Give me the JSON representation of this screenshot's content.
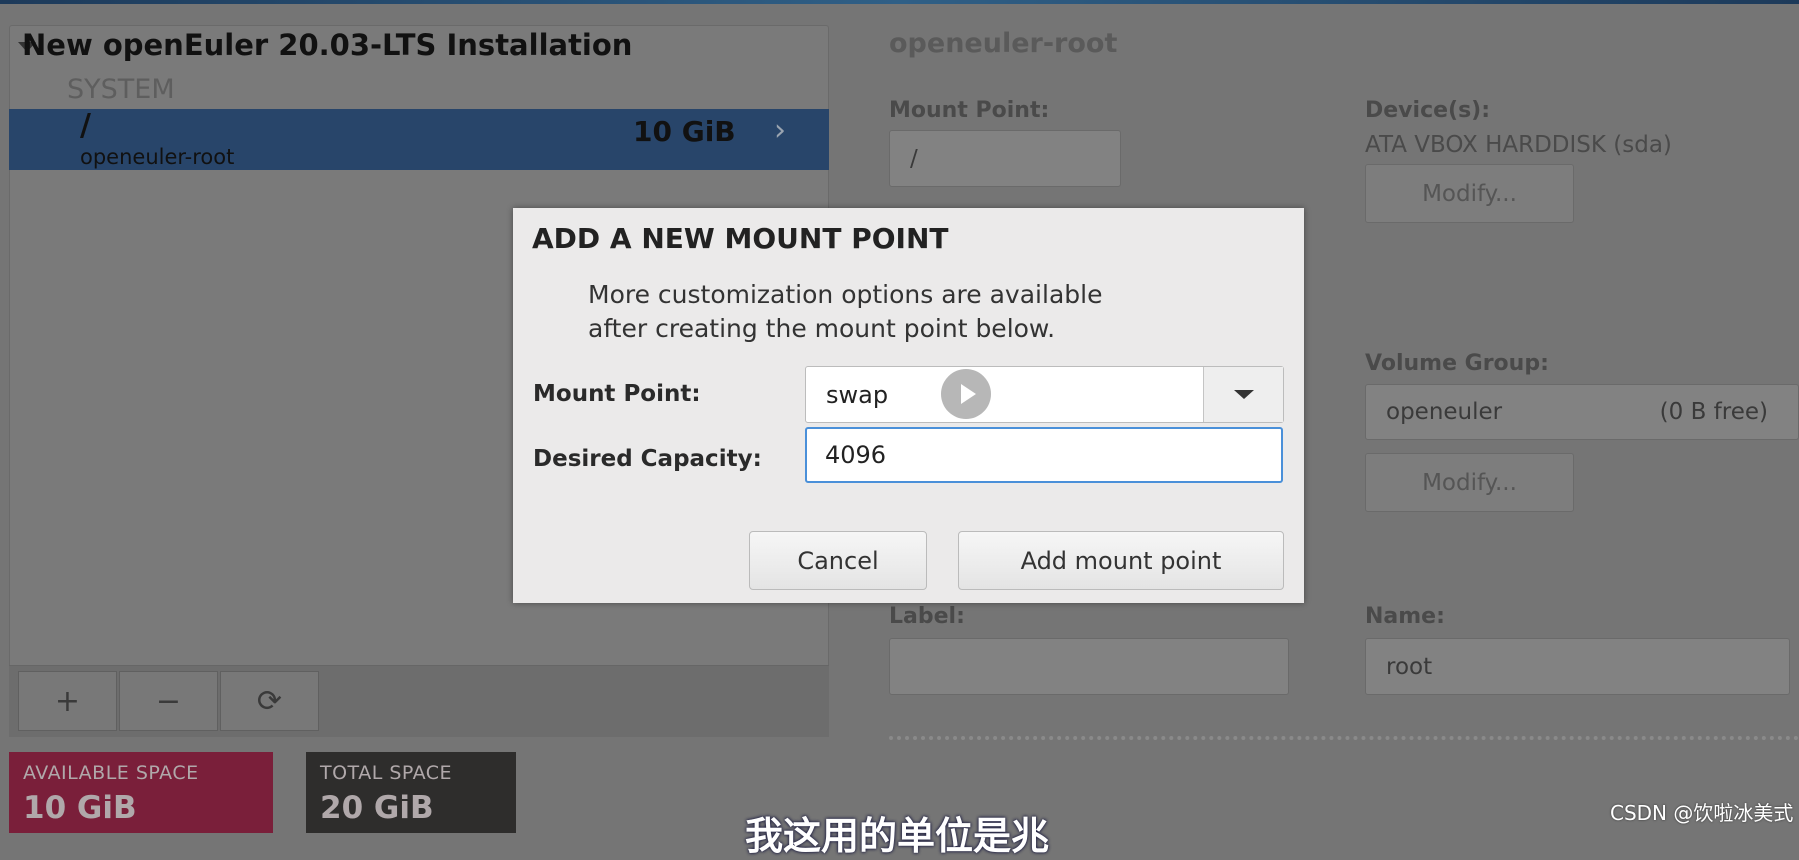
{
  "left_panel": {
    "title": "New openEuler 20.03-LTS Installation",
    "section": "SYSTEM",
    "items": [
      {
        "mount": "/",
        "name": "openeuler-root",
        "size": "10 GiB"
      }
    ],
    "toolbar": {
      "add": "+",
      "remove": "−",
      "refresh": "⟳"
    }
  },
  "space": {
    "available_label": "AVAILABLE SPACE",
    "available_value": "10 GiB",
    "total_label": "TOTAL SPACE",
    "total_value": "20 GiB",
    "available_color": "#7a1f3a",
    "total_color": "#2e2d2c"
  },
  "details": {
    "title": "openeuler-root",
    "mount_point_label": "Mount Point:",
    "mount_point_value": "/",
    "devices_label": "Device(s):",
    "devices_value": "ATA VBOX HARDDISK (sda)",
    "modify": "Modify...",
    "volume_group_label": "Volume Group:",
    "volume_group_value": "openeuler",
    "volume_group_free": "(0 B free)",
    "label_label": "Label:",
    "label_value": "",
    "name_label": "Name:",
    "name_value": "root"
  },
  "dialog": {
    "title": "ADD A NEW MOUNT POINT",
    "desc1": "More customization options are available",
    "desc2": "after creating the mount point below.",
    "mount_point_label": "Mount Point:",
    "mount_point_value": "swap",
    "capacity_label": "Desired Capacity:",
    "capacity_value": "4096",
    "cancel": "Cancel",
    "add": "Add mount point"
  },
  "overlay": {
    "subtitle": "我这用的单位是兆",
    "watermark": "CSDN @饮啦冰美式"
  }
}
